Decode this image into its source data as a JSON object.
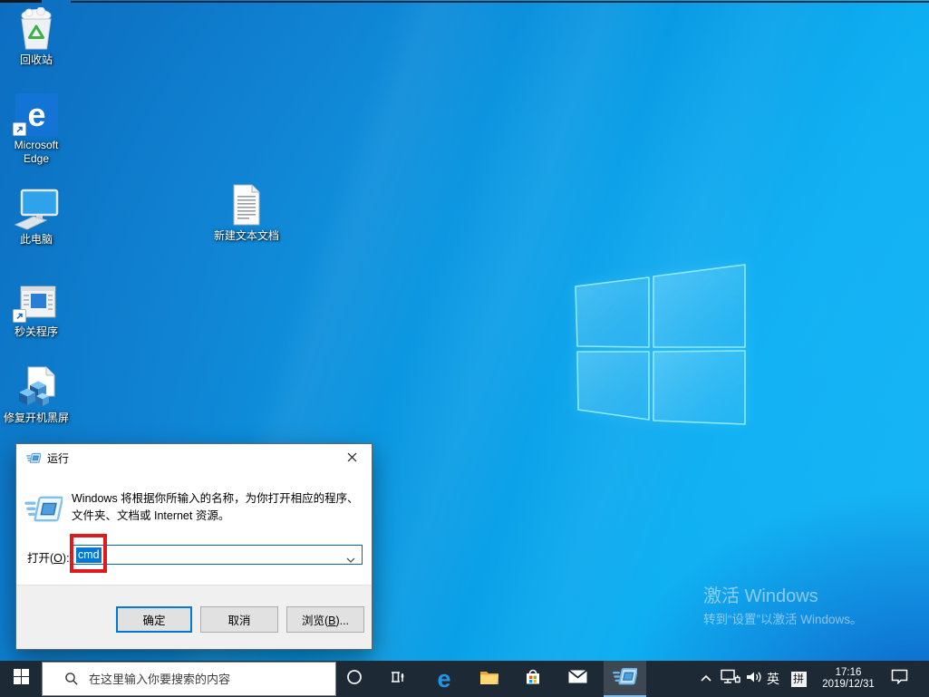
{
  "desktop": {
    "icons": [
      {
        "label": "回收站"
      },
      {
        "label": "Microsoft Edge"
      },
      {
        "label": "此电脑"
      },
      {
        "label": "秒关程序"
      },
      {
        "label": "修复开机黑屏"
      },
      {
        "label": "新建文本文档"
      }
    ],
    "watermark": {
      "title": "激活 Windows",
      "subtitle": "转到“设置”以激活 Windows。"
    }
  },
  "run_dialog": {
    "title": "运行",
    "description": "Windows 将根据你所输入的名称，为你打开相应的程序、文件夹、文档或 Internet 资源。",
    "open_label": {
      "prefix": "打开(",
      "key": "O",
      "suffix": "):"
    },
    "input_value": "cmd",
    "buttons": {
      "ok": "确定",
      "cancel": "取消",
      "browse_prefix": "浏览(",
      "browse_key": "B",
      "browse_suffix": ")..."
    }
  },
  "taskbar": {
    "search_placeholder": "在这里输入你要搜索的内容",
    "tray": {
      "language": "英",
      "ime": "拼",
      "time": "17:16",
      "date": "2019/12/31"
    }
  },
  "annotation": {
    "purpose": "highlight cmd input",
    "color": "#e0191c"
  },
  "colors": {
    "accent": "#0078d7",
    "selection": "#0078d7",
    "taskbar_background": "#1d2935",
    "active_task_underline": "#76b9ed",
    "combobox_border": "#0066b4"
  },
  "icons": {
    "recycle-bin": "trash bin with green recycle mark",
    "edge": "blue letter e",
    "this-pc": "monitor with keyboard",
    "program-window": "application window with shortcut arrow",
    "registry-cubes": "document with blue cubes",
    "text-document": "lined page",
    "run": "skewed window with speed lines",
    "start": "windows flag",
    "search": "magnifier",
    "cortana": "circle",
    "task-view": "timeline rectangles",
    "file-explorer": "yellow folder",
    "store": "shopping bag with windows logo",
    "mail": "envelope",
    "chevron-up": "^",
    "network": "monitor with plug",
    "volume": "speaker with waves",
    "input-indicator": "拼 square",
    "action-center": "speech bubble",
    "close": "X",
    "combo-chevron": "v"
  }
}
